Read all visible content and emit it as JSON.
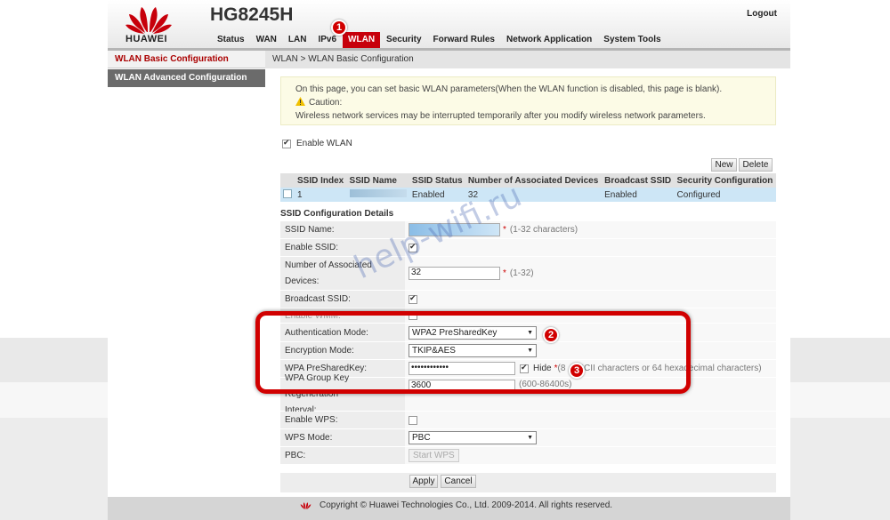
{
  "header": {
    "brand": "HUAWEI",
    "model": "HG8245H",
    "logout": "Logout",
    "nav": [
      "Status",
      "WAN",
      "LAN",
      "IPv6",
      "WLAN",
      "Security",
      "Forward Rules",
      "Network Application",
      "System Tools"
    ],
    "active_nav": "WLAN"
  },
  "sidebar": {
    "items": [
      "WLAN Basic Configuration",
      "WLAN Advanced Configuration"
    ]
  },
  "breadcrumb": "WLAN > WLAN Basic Configuration",
  "notice": {
    "line1": "On this page, you can set basic WLAN parameters(When the WLAN function is disabled, this page is blank).",
    "caution": "Caution:",
    "line2": "Wireless network services may be interrupted temporarily after you modify wireless network parameters."
  },
  "enable_wlan": {
    "label": "Enable WLAN",
    "checked": true
  },
  "buttons": {
    "new": "New",
    "delete": "Delete",
    "apply": "Apply",
    "cancel": "Cancel",
    "start_wps": "Start WPS"
  },
  "ssid_table": {
    "headers": [
      "SSID Index",
      "SSID Name",
      "SSID Status",
      "Number of Associated Devices",
      "Broadcast SSID",
      "Security Configuration"
    ],
    "row": {
      "index": "1",
      "status": "Enabled",
      "devices": "32",
      "broadcast": "Enabled",
      "security": "Configured"
    }
  },
  "section_title": "SSID Configuration Details",
  "form": {
    "ssid_name": {
      "label": "SSID Name:",
      "hint": "(1-32 characters)"
    },
    "enable_ssid": {
      "label": "Enable SSID:"
    },
    "assoc_devices": {
      "label1": "Number of Associated",
      "label2": "Devices:",
      "value": "32",
      "hint": "(1-32)"
    },
    "broadcast_ssid": {
      "label": "Broadcast SSID:"
    },
    "enable_wmm": {
      "label": "Enable WMM:"
    },
    "auth_mode": {
      "label": "Authentication Mode:",
      "value": "WPA2 PreSharedKey"
    },
    "enc_mode": {
      "label": "Encryption Mode:",
      "value": "TKIP&AES"
    },
    "wpa_key": {
      "label": "WPA PreSharedKey:",
      "value": "••••••••••••",
      "hide": "Hide",
      "hint": "(8",
      "hint2": "SCII characters or 64 hexadecimal characters)"
    },
    "key_interval": {
      "label1": "WPA Group Key Regeneration",
      "label2": "Interval:",
      "value": "3600",
      "hint": "(600-86400s)"
    },
    "enable_wps": {
      "label": "Enable WPS:"
    },
    "wps_mode": {
      "label": "WPS Mode:",
      "value": "PBC"
    },
    "pbc": {
      "label": "PBC:"
    }
  },
  "footer": "Copyright © Huawei Technologies Co., Ltd. 2009-2014. All rights reserved.",
  "watermark": "help-wifi.ru",
  "markers": [
    "1",
    "2",
    "3"
  ],
  "colors": {
    "accent": "#c7000b",
    "highlight": "#d10000"
  }
}
